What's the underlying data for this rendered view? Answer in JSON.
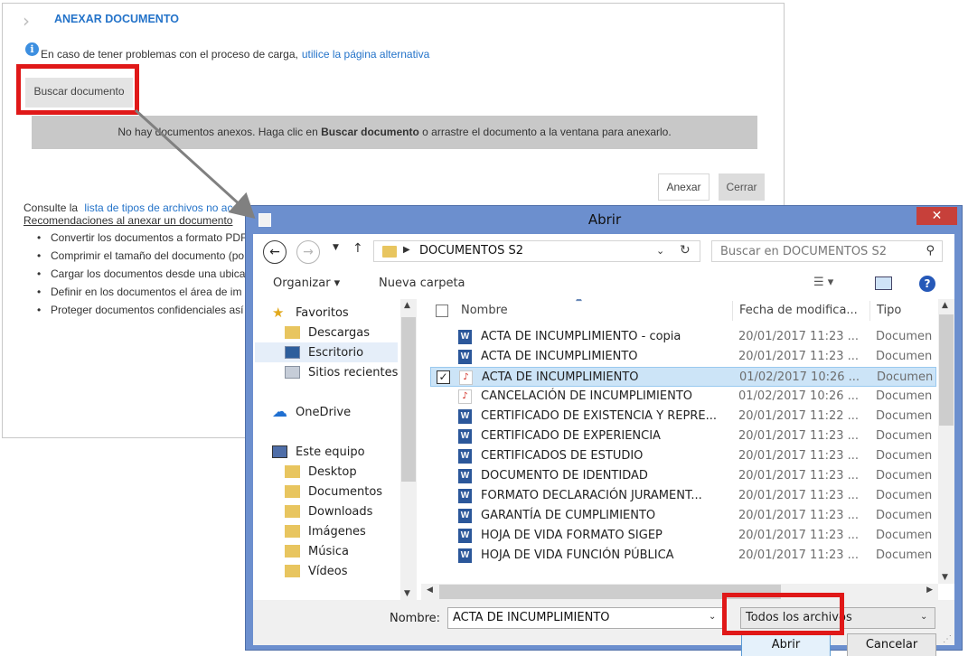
{
  "web_panel": {
    "title": "ANEXAR DOCUMENTO",
    "info_text": "En caso de tener problemas con el proceso de carga,",
    "info_link": "utilice la página alternativa",
    "buscar_button": "Buscar documento",
    "drop_text_before": "No hay documentos anexos. Haga clic en",
    "drop_text_bold": "Buscar documento",
    "drop_text_after": "o arrastre el documento a la ventana para anexarlo.",
    "anexar_button": "Anexar",
    "cerrar_button": "Cerrar",
    "consult_text": "Consulte la",
    "consult_link": "lista de tipos de archivos no acep",
    "recommendations_title": "Recomendaciones al anexar un documento",
    "recommendations": [
      "Convertir los documentos a formato PDF",
      "Comprimir el tamaño del documento (po",
      "Cargar los documentos desde una ubica",
      "Definir en los documentos el área de im",
      "Proteger documentos confidenciales así"
    ]
  },
  "dialog": {
    "title": "Abrir",
    "close_label": "✕",
    "address_path": "DOCUMENTOS S2",
    "search_placeholder": "Buscar en DOCUMENTOS S2",
    "toolbar": {
      "organizar": "Organizar ▾",
      "nueva_carpeta": "Nueva carpeta",
      "help": "?"
    },
    "nav_items": [
      {
        "label": "Favoritos",
        "icon": "star-icon"
      },
      {
        "label": "Descargas",
        "icon": "downloads-folder-icon"
      },
      {
        "label": "Escritorio",
        "icon": "desktop-icon",
        "selected": true
      },
      {
        "label": "Sitios recientes",
        "icon": "recent-places-icon"
      },
      {
        "label": "OneDrive",
        "icon": "cloud-icon"
      },
      {
        "label": "Este equipo",
        "icon": "computer-icon"
      },
      {
        "label": "Desktop",
        "icon": "folder-icon"
      },
      {
        "label": "Documentos",
        "icon": "folder-icon"
      },
      {
        "label": "Downloads",
        "icon": "folder-icon"
      },
      {
        "label": "Imágenes",
        "icon": "folder-icon"
      },
      {
        "label": "Música",
        "icon": "folder-icon"
      },
      {
        "label": "Vídeos",
        "icon": "folder-icon"
      }
    ],
    "columns": {
      "name": "Nombre",
      "date": "Fecha de modifica...",
      "type": "Tipo"
    },
    "files": [
      {
        "name": "ACTA DE INCUMPLIMIENTO - copia",
        "date": "20/01/2017 11:23 ...",
        "type": "Documen",
        "kind": "word"
      },
      {
        "name": "ACTA DE INCUMPLIMIENTO",
        "date": "20/01/2017 11:23 ...",
        "type": "Documen",
        "kind": "word"
      },
      {
        "name": "ACTA DE INCUMPLIMIENTO",
        "date": "01/02/2017 10:26 ...",
        "type": "Documen",
        "kind": "pdf",
        "selected": true
      },
      {
        "name": "CANCELACIÓN DE INCUMPLIMIENTO",
        "date": "01/02/2017 10:26 ...",
        "type": "Documen",
        "kind": "pdf"
      },
      {
        "name": "CERTIFICADO DE EXISTENCIA Y REPRE...",
        "date": "20/01/2017 11:22 ...",
        "type": "Documen",
        "kind": "word"
      },
      {
        "name": "CERTIFICADO DE EXPERIENCIA",
        "date": "20/01/2017 11:23 ...",
        "type": "Documen",
        "kind": "word"
      },
      {
        "name": "CERTIFICADOS DE ESTUDIO",
        "date": "20/01/2017 11:23 ...",
        "type": "Documen",
        "kind": "word"
      },
      {
        "name": "DOCUMENTO DE IDENTIDAD",
        "date": "20/01/2017 11:23 ...",
        "type": "Documen",
        "kind": "word"
      },
      {
        "name": "FORMATO DECLARACIÓN JURAMENT...",
        "date": "20/01/2017 11:23 ...",
        "type": "Documen",
        "kind": "word"
      },
      {
        "name": "GARANTÍA DE CUMPLIMIENTO",
        "date": "20/01/2017 11:23 ...",
        "type": "Documen",
        "kind": "word"
      },
      {
        "name": "HOJA DE VIDA FORMATO SIGEP",
        "date": "20/01/2017 11:23 ...",
        "type": "Documen",
        "kind": "word"
      },
      {
        "name": "HOJA DE VIDA FUNCIÓN PÚBLICA",
        "date": "20/01/2017 11:23 ...",
        "type": "Documen",
        "kind": "word"
      }
    ],
    "filename_label": "Nombre:",
    "filename_value": "ACTA DE INCUMPLIMIENTO",
    "filetype_value": "Todos los archivos",
    "open_button": "Abrir",
    "cancel_button": "Cancelar"
  },
  "colors": {
    "highlight_red": "#e01818",
    "link_blue": "#2473c9",
    "dialog_frame": "#6c8fce",
    "close_red": "#c7403a"
  }
}
